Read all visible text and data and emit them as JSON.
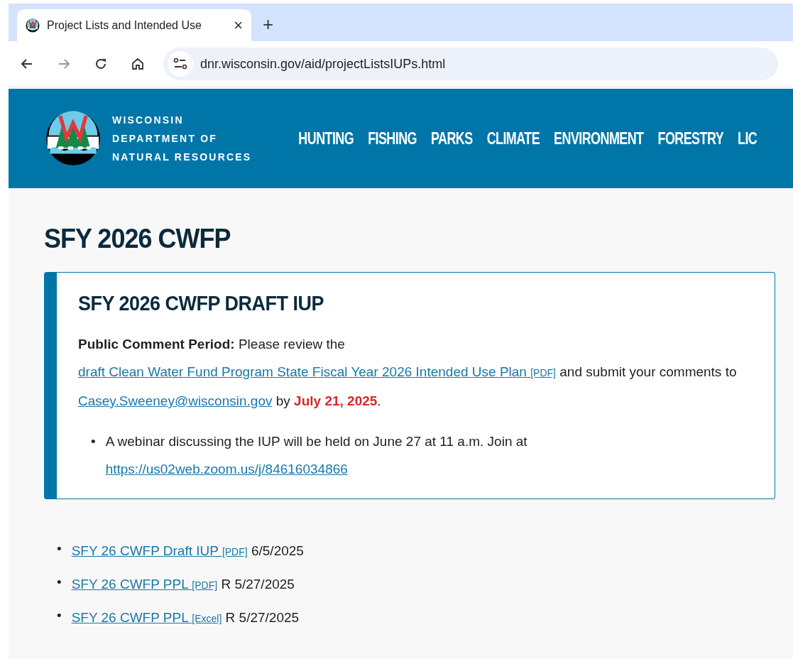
{
  "browser": {
    "tab_title": "Project Lists and Intended Use",
    "new_tab": "+",
    "close": "×",
    "url": "dnr.wisconsin.gov/aid/projectListsIUPs.html"
  },
  "header": {
    "org_lines": [
      "WISCONSIN",
      "DEPARTMENT OF",
      "NATURAL RESOURCES"
    ],
    "nav": [
      "HUNTING",
      "FISHING",
      "PARKS",
      "CLIMATE",
      "ENVIRONMENT",
      "FORESTRY",
      "LIC"
    ]
  },
  "page_title": "SFY 2026 CWFP",
  "notice": {
    "title": "SFY 2026 CWFP DRAFT IUP",
    "label": "Public Comment Period:",
    "text_before": "Please review the",
    "link": "draft Clean Water Fund Program State Fiscal Year 2026 Intended Use Plan",
    "link_tag": "[PDF]",
    "text_middle": "and submit your comments to",
    "email": "Casey.Sweeney@wisconsin.gov",
    "text_by": "by",
    "deadline": "July 21, 2025",
    "text_end": ".",
    "bullets": [
      {
        "marker": "•",
        "text": "A webinar discussing the IUP will be held on June 27 at 11 a.m. Join at",
        "link": "https://us02web.zoom.us/j/84616034866"
      }
    ]
  },
  "documents": [
    {
      "marker": "•",
      "link": "SFY 26 CWFP Draft IUP",
      "tag": "[PDF]",
      "date": "6/5/2025"
    },
    {
      "marker": "•",
      "link": "SFY 26 CWFP PPL",
      "tag": "[PDF]",
      "date": "R 5/27/2025"
    },
    {
      "marker": "•",
      "link": "SFY 26 CWFP PPL",
      "tag": "[Excel]",
      "date": "R 5/27/2025"
    }
  ]
}
